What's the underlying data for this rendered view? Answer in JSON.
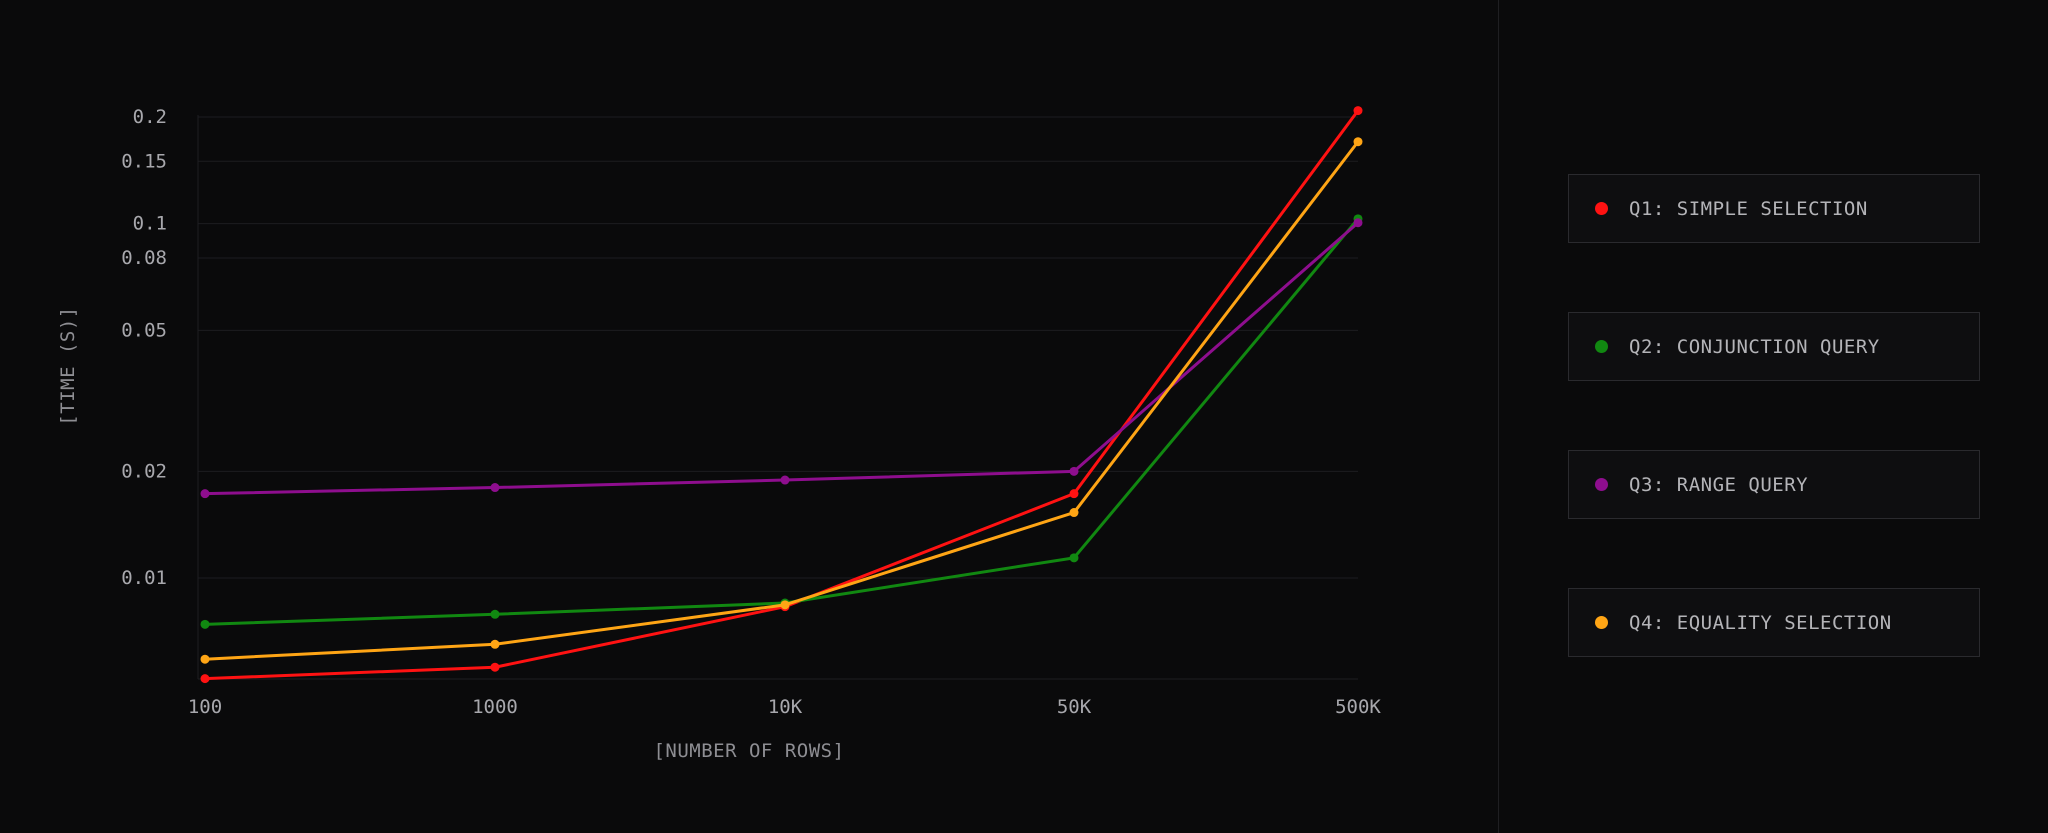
{
  "chart_data": {
    "type": "line",
    "xlabel": "[NUMBER OF ROWS]",
    "ylabel": "[TIME (S)]",
    "y_scale": "log",
    "ylim": [
      0.0045,
      0.21
    ],
    "x_categories": [
      "100",
      "1000",
      "10K",
      "50K",
      "500K"
    ],
    "y_ticks": [
      {
        "value": 0.2,
        "label": "0.2"
      },
      {
        "value": 0.15,
        "label": "0.15"
      },
      {
        "value": 0.1,
        "label": "0.1"
      },
      {
        "value": 0.08,
        "label": "0.08"
      },
      {
        "value": 0.05,
        "label": "0.05"
      },
      {
        "value": 0.02,
        "label": "0.02"
      },
      {
        "value": 0.01,
        "label": "0.01"
      }
    ],
    "grid": true,
    "legend_position": "right",
    "series": [
      {
        "name": "Q1: SIMPLE SELECTION",
        "color": "#ff1212",
        "values": [
          0.0052,
          0.0056,
          0.0083,
          0.0173,
          0.2085
        ]
      },
      {
        "name": "Q2: CONJUNCTION QUERY",
        "color": "#118811",
        "values": [
          0.0074,
          0.0079,
          0.0085,
          0.0114,
          0.1032
        ]
      },
      {
        "name": "Q3: RANGE QUERY",
        "color": "#8e0e8e",
        "values": [
          0.0173,
          0.018,
          0.0189,
          0.02,
          0.1006
        ]
      },
      {
        "name": "Q4: EQUALITY SELECTION",
        "color": "#ffa515",
        "values": [
          0.0059,
          0.0065,
          0.0084,
          0.0153,
          0.1703
        ]
      }
    ]
  }
}
